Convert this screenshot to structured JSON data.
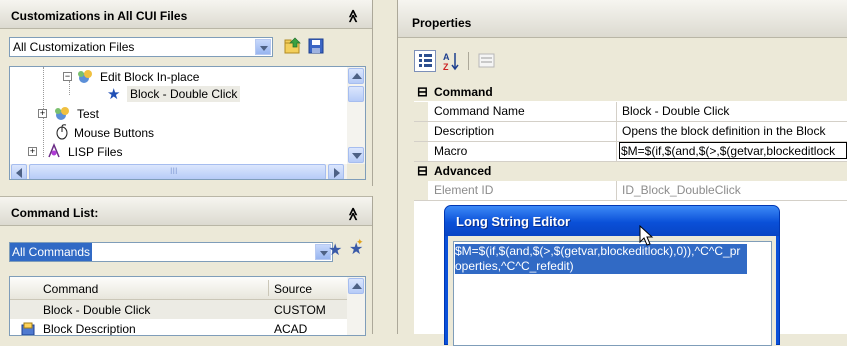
{
  "customizations": {
    "title": "Customizations in All CUI Files",
    "collapse_glyph": "≪",
    "filter": "All Customization Files",
    "tree": [
      {
        "label": "Edit Block In-place",
        "expander": "−",
        "icon": "group-icon"
      },
      {
        "label": "Block - Double Click",
        "icon": "star-icon",
        "selected": true
      },
      {
        "label": "Test",
        "expander": "+",
        "icon": "group-icon"
      },
      {
        "label": "Mouse Buttons",
        "icon": "mouse-icon"
      },
      {
        "label": "LISP Files",
        "expander": "+",
        "icon": "lisp-icon"
      }
    ],
    "hscroll_grip": "III"
  },
  "command_list": {
    "title": "Command List:",
    "collapse_glyph": "≪",
    "filter": "All Commands",
    "columns": [
      "Command",
      "Source"
    ],
    "rows": [
      {
        "command": "Block - Double Click",
        "source": "CUSTOM"
      },
      {
        "command": "Block Description",
        "source": "ACAD"
      }
    ]
  },
  "properties": {
    "title": "Properties",
    "categories": [
      {
        "name": "Command",
        "toggle": "⊟",
        "rows": [
          {
            "name": "Command Name",
            "value": "Block - Double Click"
          },
          {
            "name": "Description",
            "value": "Opens the block definition in the Block"
          },
          {
            "name": "Macro",
            "value": "$M=$(if,$(and,$(>,$(getvar,blockeditlock"
          }
        ]
      },
      {
        "name": "Advanced",
        "toggle": "⊟",
        "rows": [
          {
            "name": "Element ID",
            "value": "ID_Block_DoubleClick"
          }
        ]
      }
    ]
  },
  "long_string_editor": {
    "title": "Long String Editor",
    "text": "$M=$(if,$(and,$(>,$(getvar,blockeditlock),0)),^C^C_properties,^C^C_refedit)"
  },
  "colors": {
    "selection": "#316ac5",
    "xp_title": "#0a50d8",
    "panel_bg": "#ece9d8"
  }
}
